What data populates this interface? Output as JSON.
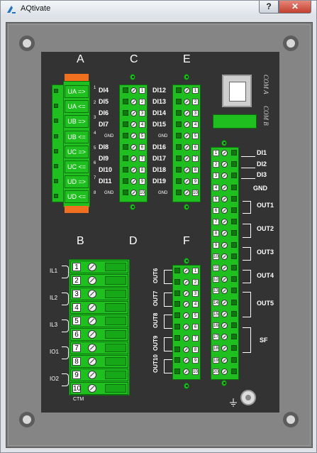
{
  "window": {
    "title": "AQtivate",
    "help_label": "?",
    "close_label": "✕"
  },
  "sections": {
    "A": "A",
    "B": "B",
    "C": "C",
    "D": "D",
    "E": "E",
    "F": "F"
  },
  "connector_a": {
    "rows": [
      "UA =>",
      "UA <=",
      "UB =>",
      "UB <=",
      "UC =>",
      "UC <=",
      "UD =>",
      "UD <="
    ],
    "pins": [
      "1",
      "2",
      "3",
      "4",
      "5",
      "6",
      "7",
      "8"
    ]
  },
  "connector_c": {
    "labels": [
      "DI4",
      "DI5",
      "DI6",
      "DI7",
      "GND",
      "DI8",
      "DI9",
      "DI10",
      "DI11",
      "GND"
    ]
  },
  "connector_e": {
    "labels": [
      "DI12",
      "DI13",
      "DI14",
      "DI15",
      "GND",
      "DI16",
      "DI17",
      "DI18",
      "DI19",
      "GND"
    ]
  },
  "connector_b": {
    "numbers": [
      "1",
      "2",
      "3",
      "4",
      "5",
      "6",
      "7",
      "8",
      "9",
      "10"
    ],
    "groups": [
      "IL1",
      "IL2",
      "IL3",
      "IO1",
      "IO2"
    ],
    "footer": "CTM"
  },
  "connector_f": {
    "outputs": [
      "OUT6",
      "OUT7",
      "OUT8",
      "OUT9",
      "OUT10"
    ]
  },
  "connector_big": {
    "labels": [
      "DI1",
      "DI2",
      "DI3",
      "GND",
      "OUT1",
      "OUT2",
      "OUT3",
      "OUT4",
      "OUT5",
      "SF"
    ]
  },
  "com_labels": {
    "com_a": "COM A",
    "com_b": "COM B"
  },
  "numbers_1_20": [
    "1",
    "2",
    "3",
    "4",
    "5",
    "6",
    "7",
    "8",
    "9",
    "10",
    "11",
    "12",
    "13",
    "14",
    "15",
    "16",
    "17",
    "18",
    "19",
    "20"
  ],
  "colors": {
    "terminal_green": "#1fbf1f",
    "cap_orange": "#f07020",
    "panel": "#333333",
    "device": "#7a7a7a"
  }
}
